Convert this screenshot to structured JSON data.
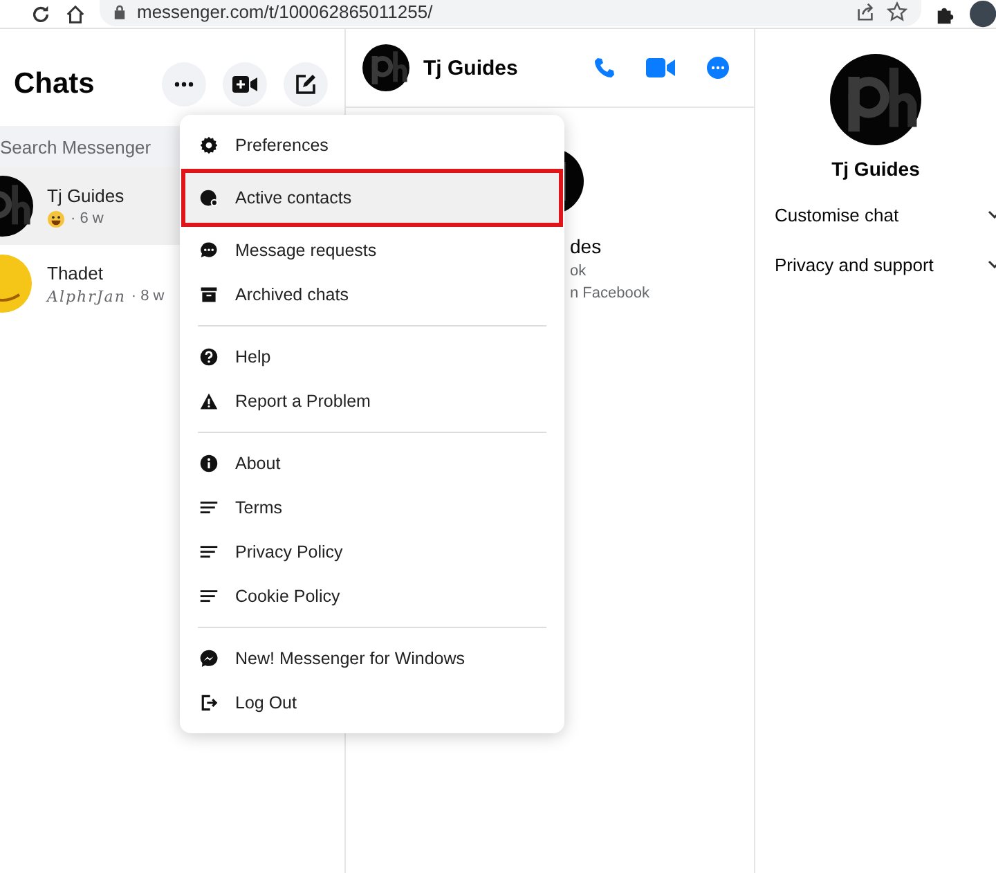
{
  "browser": {
    "url": "messenger.com/t/100062865011255/"
  },
  "sidebar": {
    "title": "Chats",
    "search": {
      "placeholder": "Search Messenger"
    },
    "chats": [
      {
        "name": "Tj Guides",
        "preview": "· 6 w",
        "kind": "logo",
        "selected": true
      },
      {
        "name": "Thadet",
        "preview": "AlphrJan",
        "time": "· 8 w",
        "kind": "emoji",
        "selected": false
      }
    ]
  },
  "conversation": {
    "name": "Tj Guides",
    "profile_texts": [
      "des",
      "ok",
      "n Facebook"
    ]
  },
  "details": {
    "name": "Tj Guides",
    "sections": [
      "Customise chat",
      "Privacy and support"
    ]
  },
  "menu": {
    "sections": [
      [
        {
          "label": "Preferences",
          "kind": "gear",
          "highlighted": false
        },
        {
          "label": "Active contacts",
          "kind": "contacts",
          "highlighted": true
        },
        {
          "label": "Message requests",
          "kind": "bubble",
          "highlighted": false
        },
        {
          "label": "Archived chats",
          "kind": "archive",
          "highlighted": false
        }
      ],
      [
        {
          "label": "Help",
          "kind": "help",
          "highlighted": false
        },
        {
          "label": "Report a Problem",
          "kind": "warning",
          "highlighted": false
        }
      ],
      [
        {
          "label": "About",
          "kind": "info",
          "highlighted": false
        },
        {
          "label": "Terms",
          "kind": "lines",
          "highlighted": false
        },
        {
          "label": "Privacy Policy",
          "kind": "lines",
          "highlighted": false
        },
        {
          "label": "Cookie Policy",
          "kind": "lines",
          "highlighted": false
        }
      ],
      [
        {
          "label": "New! Messenger for Windows",
          "kind": "messenger",
          "highlighted": false
        },
        {
          "label": "Log Out",
          "kind": "logout",
          "highlighted": false
        }
      ]
    ]
  }
}
